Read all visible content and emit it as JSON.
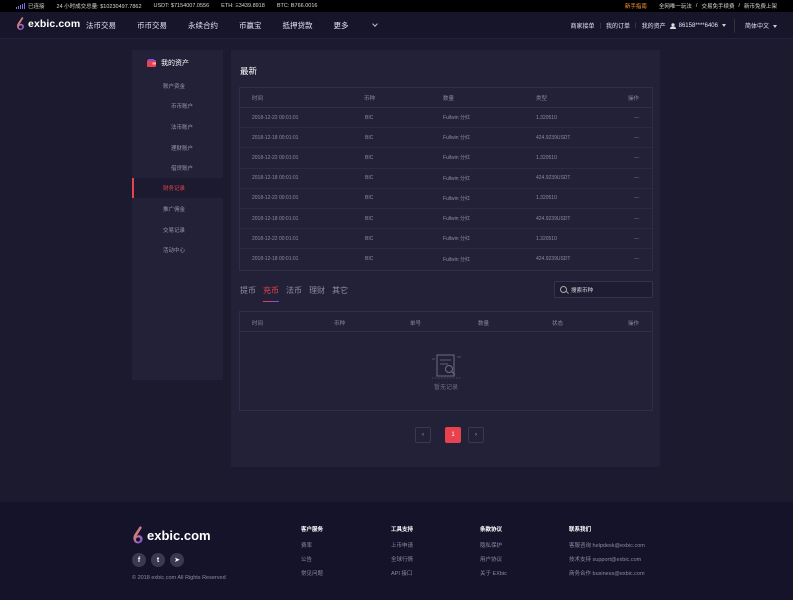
{
  "ticker": {
    "status": "已连接",
    "volume": "24 小时成交总量: $10230497.7862",
    "usdt": "USDT: $7154007.0556",
    "eth": "ETH: Ξ3439.8918",
    "btc": "BTC: Ƀ766.0016",
    "right_highlight": "新手指南",
    "right_links": [
      "全网唯一玩法",
      "/",
      "交易免手续费",
      "/",
      "新币免费上架"
    ]
  },
  "header": {
    "logo_text": "exbic.com",
    "nav": [
      "法币交易",
      "币币交易",
      "永续合约",
      "币赢宝",
      "抵押贷款",
      "更多"
    ],
    "links": [
      "商家接单",
      "我的订单",
      "我的资产"
    ],
    "user_phone": "86158****6406",
    "language": "简体中文"
  },
  "sidebar": {
    "title": "我的资产",
    "items": [
      "账户资金",
      "币币账户",
      "法币账户",
      "理财账户",
      "借贷账户",
      "财务记录",
      "推广佣金",
      "交易记录",
      "活动中心"
    ]
  },
  "latest": {
    "title": "最新",
    "columns": [
      "时间",
      "币种",
      "数量",
      "类型",
      "操作"
    ],
    "rows": [
      [
        "2018-12-22 00:01:01",
        "BIC",
        "Fullwin 分红",
        "1.320510",
        "---"
      ],
      [
        "2018-12-18 00:01:01",
        "BIC",
        "Fullwin 分红",
        "424.9239USDT",
        "---"
      ],
      [
        "2018-12-22 00:01:01",
        "BIC",
        "Fullwin 分红",
        "1.320510",
        "---"
      ],
      [
        "2018-12-18 00:01:01",
        "BIC",
        "Fullwin 分红",
        "424.9239USDT",
        "---"
      ],
      [
        "2018-12-22 00:01:01",
        "BIC",
        "Fullwin 分红",
        "1.320510",
        "---"
      ],
      [
        "2018-12-18 00:01:01",
        "BIC",
        "Fullwin 分红",
        "424.9239USDT",
        "---"
      ],
      [
        "2018-12-22 00:01:01",
        "BIC",
        "Fullwin 分红",
        "1.320510",
        "---"
      ],
      [
        "2018-12-18 00:01:01",
        "BIC",
        "Fullwin 分红",
        "424.9239USDT",
        "---"
      ]
    ]
  },
  "records": {
    "tabs": [
      "提币",
      "充币",
      "法币",
      "理财",
      "其它"
    ],
    "active_tab": "充币",
    "search_placeholder": "搜索币种",
    "columns": [
      "时间",
      "币种",
      "单号",
      "数量",
      "状态",
      "操作"
    ],
    "empty_text": "暂无记录"
  },
  "pager": {
    "prev": "‹",
    "current": "1",
    "next": "›"
  },
  "footer": {
    "logo_text": "exbic.com",
    "copyright": "© 2018 exbic.com All Rights Reserved",
    "socials": [
      "f",
      "t",
      "➤"
    ],
    "columns": [
      {
        "title": "客户服务",
        "items": [
          "费率",
          "公告",
          "常见问题"
        ]
      },
      {
        "title": "工具支持",
        "items": [
          "上币申请",
          "全球行情",
          "API 接口"
        ]
      },
      {
        "title": "条款协议",
        "items": [
          "隐私保护",
          "用户协议",
          "关于 EXbic"
        ]
      },
      {
        "title": "联系我们",
        "items": [
          "客服咨询 helpdesk@exbic.com",
          "技术支持 support@exbic.com",
          "商务合作 business@exbic.com"
        ]
      }
    ]
  },
  "colors": {
    "accent": "#e8424f",
    "bg": "#1c1a2e",
    "panel": "#232138",
    "brand_purple": "#7b4cf0",
    "brand_orange": "#ff9a3c"
  }
}
